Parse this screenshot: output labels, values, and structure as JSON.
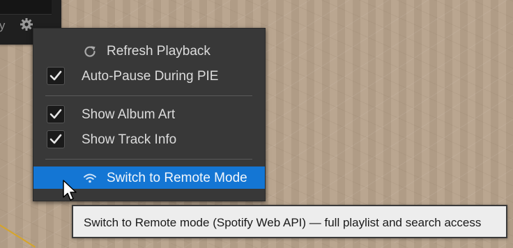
{
  "toolbar": {
    "partial_label": "ify",
    "settings_icon": "gear-icon"
  },
  "menu": {
    "items": [
      {
        "label": "Refresh Playback",
        "icon": "refresh-icon",
        "type": "action"
      },
      {
        "label": "Auto-Pause During PIE",
        "type": "checkbox",
        "checked": true
      },
      {
        "label": "Show Album Art",
        "type": "checkbox",
        "checked": true
      },
      {
        "label": "Show Track Info",
        "type": "checkbox",
        "checked": true
      },
      {
        "label": "Switch to Remote Mode",
        "icon": "wifi-icon",
        "type": "action",
        "highlighted": true
      }
    ]
  },
  "tooltip": {
    "text": "Switch to Remote mode (Spotify Web API) — full playlist and search access"
  },
  "colors": {
    "menu_bg": "#383838",
    "highlight": "#1476d4",
    "text": "#dcdcdc"
  }
}
